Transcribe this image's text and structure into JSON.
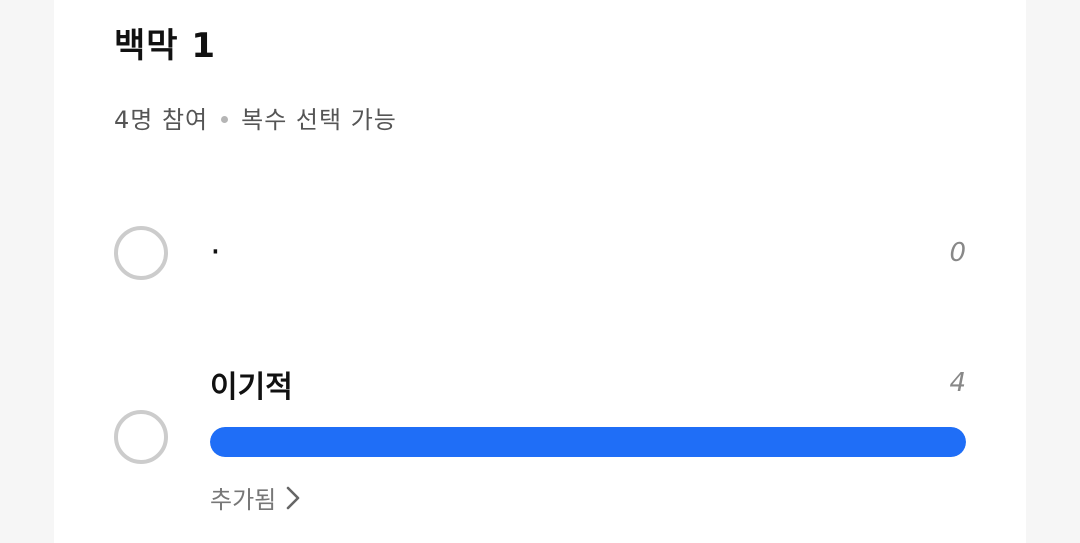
{
  "poll": {
    "title": "백막 1",
    "participants": "4명 참여",
    "multi_select": "복수 선택 가능",
    "options": [
      {
        "label": "·",
        "count": "0",
        "fraction": 0
      },
      {
        "label": "이기적",
        "count": "4",
        "fraction": 1.0,
        "added_text": "추가됨"
      }
    ]
  },
  "colors": {
    "bar": "#1f6ef7",
    "radio_border": "#cccccc"
  },
  "icons": {
    "added_chevron": "chevron-right-icon"
  }
}
